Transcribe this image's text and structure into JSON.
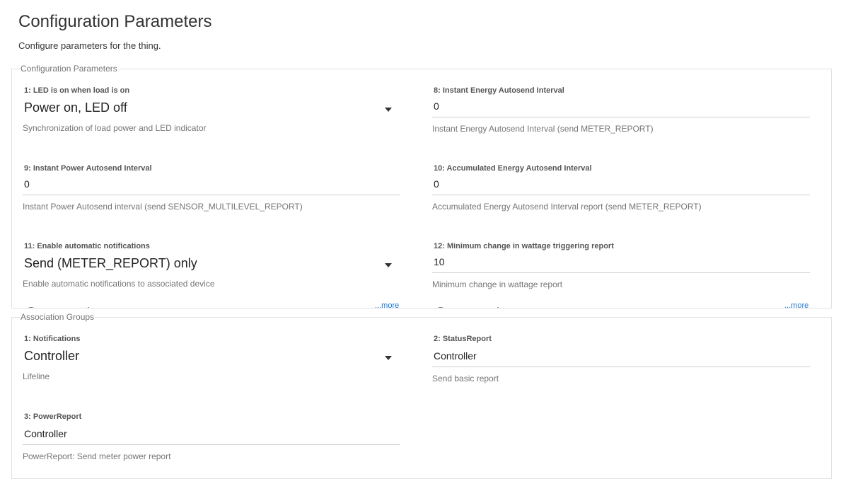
{
  "page": {
    "title": "Configuration Parameters",
    "subtitle": "Configure parameters for the thing."
  },
  "config_group": {
    "legend": "Configuration Parameters",
    "params": [
      {
        "label": "1: LED is on when load is on",
        "type": "select",
        "value": "Power on, LED off",
        "help": "Synchronization of load power and LED indicator"
      },
      {
        "label": "8: Instant Energy Autosend Interval",
        "type": "input",
        "value": "0",
        "help": "Instant Energy Autosend Interval (send METER_REPORT)"
      },
      {
        "label": "9: Instant Power Autosend Interval",
        "type": "input",
        "value": "0",
        "help": "Instant Power Autosend interval (send SENSOR_MULTILEVEL_REPORT)"
      },
      {
        "label": "10: Accumulated Energy Autosend Interval",
        "type": "input",
        "value": "0",
        "help": "Accumulated Energy Autosend Interval report (send METER_REPORT)"
      },
      {
        "label": "11: Enable automatic notifications",
        "type": "select",
        "value": "Send (METER_REPORT) only",
        "help": "Enable automatic notifications to associated device"
      },
      {
        "label": "12: Minimum change in wattage triggering report",
        "type": "input",
        "value": "10",
        "help": "Minimum change in wattage report"
      }
    ],
    "more_link": "...more"
  },
  "assoc_group": {
    "legend": "Association Groups",
    "params": [
      {
        "label": "1: Notifications",
        "type": "select",
        "value": "Controller",
        "help": "Lifeline"
      },
      {
        "label": "2: StatusReport",
        "type": "input",
        "value": "Controller",
        "help": "Send basic report"
      },
      {
        "label": "3: PowerReport",
        "type": "input",
        "value": "Controller",
        "help": "PowerReport: Send meter power report"
      }
    ]
  },
  "icons": {
    "dropdown": "caret-down-icon",
    "loading": "loading-spinner-icon"
  },
  "colors": {
    "link": "#1976d2",
    "label": "#555555",
    "help": "#757575",
    "border": "#e0e0e0"
  }
}
